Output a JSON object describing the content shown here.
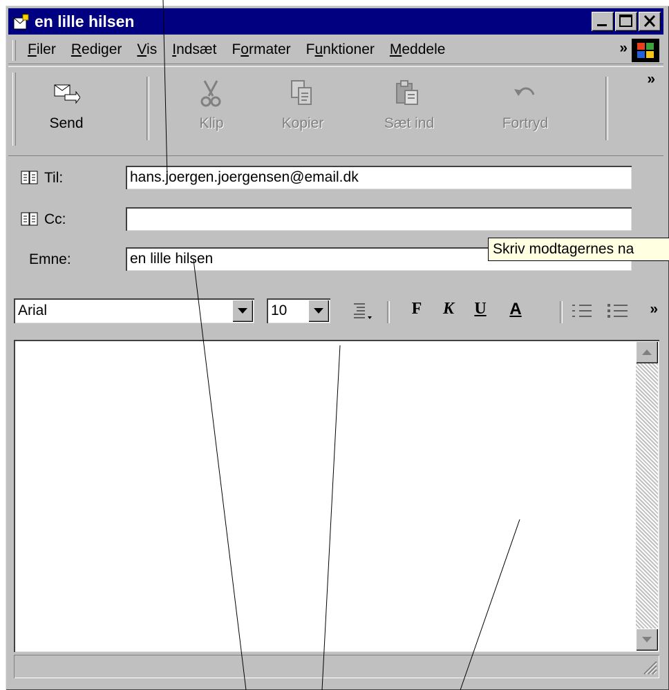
{
  "window": {
    "title": "en lille hilsen",
    "icons": {
      "app": "compose-message-icon",
      "minimize": "minimize-icon",
      "maximize": "maximize-icon",
      "close": "close-icon"
    }
  },
  "menu": {
    "items": [
      {
        "accel": "F",
        "rest": "iler"
      },
      {
        "accel": "R",
        "rest": "ediger"
      },
      {
        "accel": "V",
        "rest": "is"
      },
      {
        "accel": "I",
        "rest": "ndsæt"
      },
      {
        "pre": "F",
        "accel": "o",
        "rest": "rmater"
      },
      {
        "pre": "F",
        "accel": "u",
        "rest": "nktioner"
      },
      {
        "accel": "M",
        "rest": "eddele"
      }
    ],
    "overflow": "»",
    "logo_icon": "windows-logo-icon"
  },
  "toolbar": {
    "send": "Send",
    "cut": "Klip",
    "copy": "Kopier",
    "paste": "Sæt ind",
    "undo": "Fortryd",
    "overflow": "»"
  },
  "headers": {
    "to_label": "Til:",
    "to_value": "hans.joergen.joergensen@email.dk",
    "cc_label": "Cc:",
    "cc_value": "",
    "subject_label": "Emne:",
    "subject_value": "en lille hilsen",
    "book_icon": "address-book-icon"
  },
  "tooltip": {
    "text": "Skriv modtagernes na"
  },
  "format": {
    "font": "Arial",
    "size": "10",
    "bold": "F",
    "italic": "K",
    "underline": "U",
    "color": "A",
    "overflow": "»"
  },
  "body": {
    "text": ""
  },
  "status": {
    "text": ""
  }
}
